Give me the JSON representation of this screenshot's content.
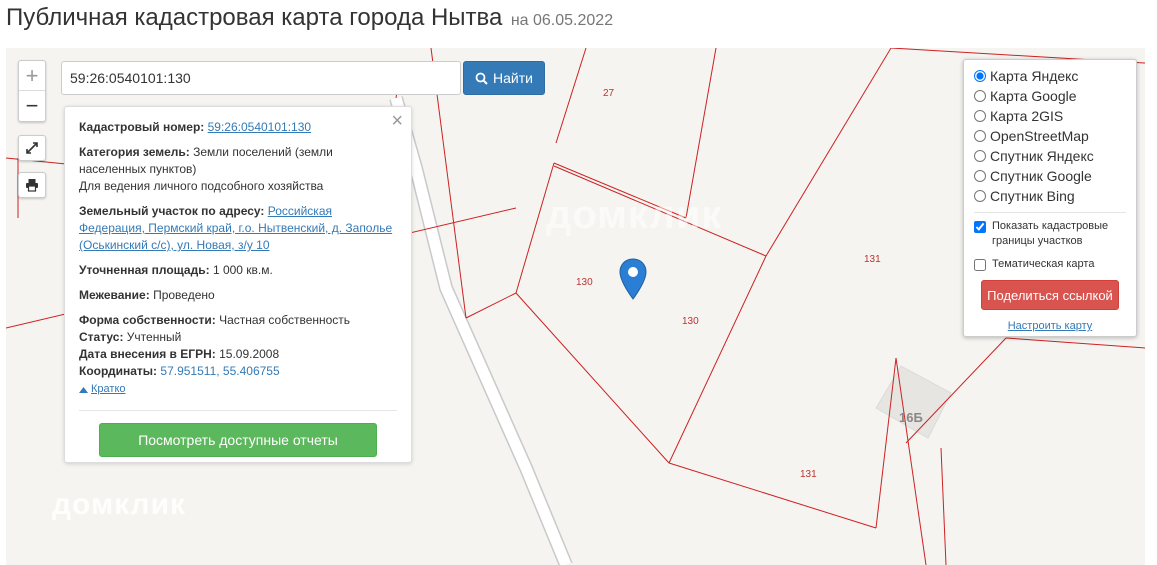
{
  "header": {
    "title": "Публичная кадастровая карта города Нытва",
    "date": "на 06.05.2022"
  },
  "toolbar": {
    "zoom_in": "+",
    "zoom_out": "−",
    "fullscreen_icon": "expand-icon",
    "print_icon": "printer-icon"
  },
  "search": {
    "value": "59:26:0540101:130",
    "button_label": "Найти"
  },
  "info": {
    "cadastral_label": "Кадастровый номер:",
    "cadastral_value": "59:26:0540101:130",
    "category_label": "Категория земель:",
    "category_value": "Земли поселений (земли населенных пунктов)",
    "usage": "Для ведения личного подсобного хозяйства",
    "address_label": "Земельный участок по адресу:",
    "address_value": "Российская Федерация, Пермский край, г.о. Нытвенский, д. Заполье (Оськинский с/с), ул. Новая, з/у 10",
    "area_label": "Уточненная площадь:",
    "area_value": "1 000 кв.м.",
    "survey_label": "Межевание:",
    "survey_value": "Проведено",
    "ownership_label": "Форма собственности:",
    "ownership_value": "Частная собственность",
    "status_label": "Статус:",
    "status_value": "Учтенный",
    "egrn_label": "Дата внесения в ЕГРН:",
    "egrn_value": "15.09.2008",
    "coords_label": "Координаты:",
    "coords_value": "57.951511, 55.406755",
    "collapse_label": "Кратко",
    "reports_button": "Посмотреть доступные отчеты"
  },
  "layers": {
    "options": [
      "Карта Яндекс",
      "Карта Google",
      "Карта 2GIS",
      "OpenStreetMap",
      "Спутник Яндекс",
      "Спутник Google",
      "Спутник Bing"
    ],
    "selected": "Карта Яндекс",
    "show_borders_label": "Показать кадастровые границы участков",
    "thematic_label": "Тематическая карта",
    "share_button": "Поделиться ссылкой",
    "settings_link": "Настроить карту"
  },
  "map_labels": {
    "parcel_27": "27",
    "parcel_130_a": "130",
    "parcel_130_b": "130",
    "parcel_131_a": "131",
    "parcel_131_b": "131",
    "building": "16Б",
    "watermark": "домклик"
  },
  "colors": {
    "boundary": "#cc2222",
    "primary": "#337ab7",
    "success": "#5cb85c",
    "danger": "#d9534f"
  }
}
